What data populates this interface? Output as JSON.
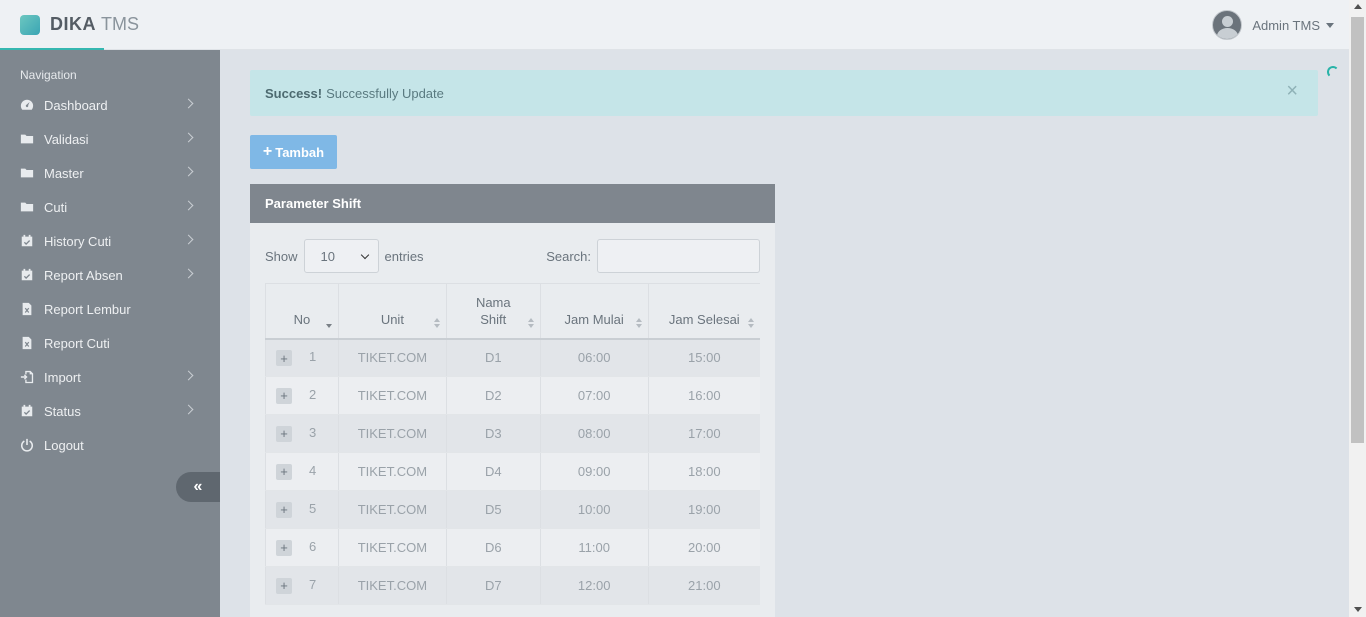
{
  "header": {
    "brand_main": "DIKA",
    "brand_sub": "TMS",
    "user_name": "Admin TMS"
  },
  "sidebar": {
    "title": "Navigation",
    "items": [
      {
        "label": "Dashboard",
        "icon": "dashboard-icon",
        "chevron": true
      },
      {
        "label": "Validasi",
        "icon": "folder-icon",
        "chevron": true
      },
      {
        "label": "Master",
        "icon": "folder-icon",
        "chevron": true
      },
      {
        "label": "Cuti",
        "icon": "folder-icon",
        "chevron": true
      },
      {
        "label": "History Cuti",
        "icon": "calendar-check-icon",
        "chevron": true
      },
      {
        "label": "Report Absen",
        "icon": "calendar-check-icon",
        "chevron": true
      },
      {
        "label": "Report Lembur",
        "icon": "excel-file-icon",
        "chevron": false
      },
      {
        "label": "Report Cuti",
        "icon": "excel-file-icon",
        "chevron": false
      },
      {
        "label": "Import",
        "icon": "import-icon",
        "chevron": true
      },
      {
        "label": "Status",
        "icon": "calendar-check-icon",
        "chevron": true
      },
      {
        "label": "Logout",
        "icon": "power-icon",
        "chevron": false
      }
    ],
    "collapse_label": "«"
  },
  "alert": {
    "strong": "Success!",
    "message": "Successfully Update",
    "close": "×"
  },
  "toolbar": {
    "add_label": "Tambah"
  },
  "panel": {
    "title": "Parameter Shift",
    "show_label": "Show",
    "entries_value": "10",
    "entries_label": "entries",
    "search_label": "Search:",
    "search_value": ""
  },
  "table": {
    "columns": [
      "No",
      "Unit",
      "Nama Shift",
      "Jam Mulai",
      "Jam Selesai"
    ],
    "rows": [
      [
        "1",
        "TIKET.COM",
        "D1",
        "06:00",
        "15:00"
      ],
      [
        "2",
        "TIKET.COM",
        "D2",
        "07:00",
        "16:00"
      ],
      [
        "3",
        "TIKET.COM",
        "D3",
        "08:00",
        "17:00"
      ],
      [
        "4",
        "TIKET.COM",
        "D4",
        "09:00",
        "18:00"
      ],
      [
        "5",
        "TIKET.COM",
        "D5",
        "10:00",
        "19:00"
      ],
      [
        "6",
        "TIKET.COM",
        "D6",
        "11:00",
        "20:00"
      ],
      [
        "7",
        "TIKET.COM",
        "D7",
        "12:00",
        "21:00"
      ]
    ]
  },
  "colors": {
    "accent": "#35b7b0",
    "sidebar_bg": "#7f878f",
    "alert_bg": "#c5e5e8",
    "button_bg": "#7fb8e6"
  }
}
